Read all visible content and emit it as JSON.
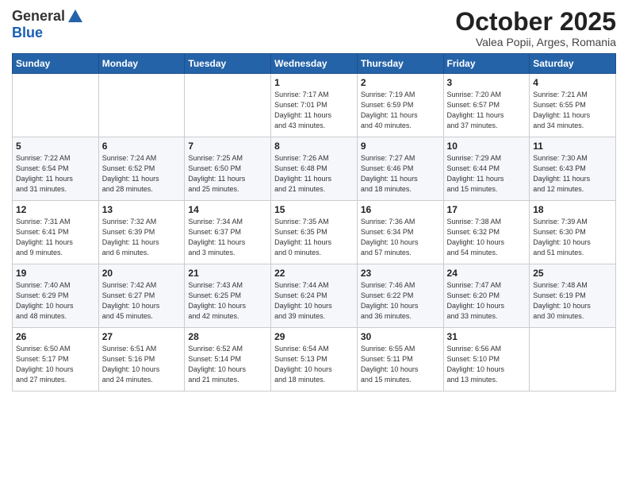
{
  "logo": {
    "general": "General",
    "blue": "Blue"
  },
  "title": "October 2025",
  "subtitle": "Valea Popii, Arges, Romania",
  "weekdays": [
    "Sunday",
    "Monday",
    "Tuesday",
    "Wednesday",
    "Thursday",
    "Friday",
    "Saturday"
  ],
  "weeks": [
    [
      {
        "day": "",
        "info": ""
      },
      {
        "day": "",
        "info": ""
      },
      {
        "day": "",
        "info": ""
      },
      {
        "day": "1",
        "info": "Sunrise: 7:17 AM\nSunset: 7:01 PM\nDaylight: 11 hours\nand 43 minutes."
      },
      {
        "day": "2",
        "info": "Sunrise: 7:19 AM\nSunset: 6:59 PM\nDaylight: 11 hours\nand 40 minutes."
      },
      {
        "day": "3",
        "info": "Sunrise: 7:20 AM\nSunset: 6:57 PM\nDaylight: 11 hours\nand 37 minutes."
      },
      {
        "day": "4",
        "info": "Sunrise: 7:21 AM\nSunset: 6:55 PM\nDaylight: 11 hours\nand 34 minutes."
      }
    ],
    [
      {
        "day": "5",
        "info": "Sunrise: 7:22 AM\nSunset: 6:54 PM\nDaylight: 11 hours\nand 31 minutes."
      },
      {
        "day": "6",
        "info": "Sunrise: 7:24 AM\nSunset: 6:52 PM\nDaylight: 11 hours\nand 28 minutes."
      },
      {
        "day": "7",
        "info": "Sunrise: 7:25 AM\nSunset: 6:50 PM\nDaylight: 11 hours\nand 25 minutes."
      },
      {
        "day": "8",
        "info": "Sunrise: 7:26 AM\nSunset: 6:48 PM\nDaylight: 11 hours\nand 21 minutes."
      },
      {
        "day": "9",
        "info": "Sunrise: 7:27 AM\nSunset: 6:46 PM\nDaylight: 11 hours\nand 18 minutes."
      },
      {
        "day": "10",
        "info": "Sunrise: 7:29 AM\nSunset: 6:44 PM\nDaylight: 11 hours\nand 15 minutes."
      },
      {
        "day": "11",
        "info": "Sunrise: 7:30 AM\nSunset: 6:43 PM\nDaylight: 11 hours\nand 12 minutes."
      }
    ],
    [
      {
        "day": "12",
        "info": "Sunrise: 7:31 AM\nSunset: 6:41 PM\nDaylight: 11 hours\nand 9 minutes."
      },
      {
        "day": "13",
        "info": "Sunrise: 7:32 AM\nSunset: 6:39 PM\nDaylight: 11 hours\nand 6 minutes."
      },
      {
        "day": "14",
        "info": "Sunrise: 7:34 AM\nSunset: 6:37 PM\nDaylight: 11 hours\nand 3 minutes."
      },
      {
        "day": "15",
        "info": "Sunrise: 7:35 AM\nSunset: 6:35 PM\nDaylight: 11 hours\nand 0 minutes."
      },
      {
        "day": "16",
        "info": "Sunrise: 7:36 AM\nSunset: 6:34 PM\nDaylight: 10 hours\nand 57 minutes."
      },
      {
        "day": "17",
        "info": "Sunrise: 7:38 AM\nSunset: 6:32 PM\nDaylight: 10 hours\nand 54 minutes."
      },
      {
        "day": "18",
        "info": "Sunrise: 7:39 AM\nSunset: 6:30 PM\nDaylight: 10 hours\nand 51 minutes."
      }
    ],
    [
      {
        "day": "19",
        "info": "Sunrise: 7:40 AM\nSunset: 6:29 PM\nDaylight: 10 hours\nand 48 minutes."
      },
      {
        "day": "20",
        "info": "Sunrise: 7:42 AM\nSunset: 6:27 PM\nDaylight: 10 hours\nand 45 minutes."
      },
      {
        "day": "21",
        "info": "Sunrise: 7:43 AM\nSunset: 6:25 PM\nDaylight: 10 hours\nand 42 minutes."
      },
      {
        "day": "22",
        "info": "Sunrise: 7:44 AM\nSunset: 6:24 PM\nDaylight: 10 hours\nand 39 minutes."
      },
      {
        "day": "23",
        "info": "Sunrise: 7:46 AM\nSunset: 6:22 PM\nDaylight: 10 hours\nand 36 minutes."
      },
      {
        "day": "24",
        "info": "Sunrise: 7:47 AM\nSunset: 6:20 PM\nDaylight: 10 hours\nand 33 minutes."
      },
      {
        "day": "25",
        "info": "Sunrise: 7:48 AM\nSunset: 6:19 PM\nDaylight: 10 hours\nand 30 minutes."
      }
    ],
    [
      {
        "day": "26",
        "info": "Sunrise: 6:50 AM\nSunset: 5:17 PM\nDaylight: 10 hours\nand 27 minutes."
      },
      {
        "day": "27",
        "info": "Sunrise: 6:51 AM\nSunset: 5:16 PM\nDaylight: 10 hours\nand 24 minutes."
      },
      {
        "day": "28",
        "info": "Sunrise: 6:52 AM\nSunset: 5:14 PM\nDaylight: 10 hours\nand 21 minutes."
      },
      {
        "day": "29",
        "info": "Sunrise: 6:54 AM\nSunset: 5:13 PM\nDaylight: 10 hours\nand 18 minutes."
      },
      {
        "day": "30",
        "info": "Sunrise: 6:55 AM\nSunset: 5:11 PM\nDaylight: 10 hours\nand 15 minutes."
      },
      {
        "day": "31",
        "info": "Sunrise: 6:56 AM\nSunset: 5:10 PM\nDaylight: 10 hours\nand 13 minutes."
      },
      {
        "day": "",
        "info": ""
      }
    ]
  ]
}
